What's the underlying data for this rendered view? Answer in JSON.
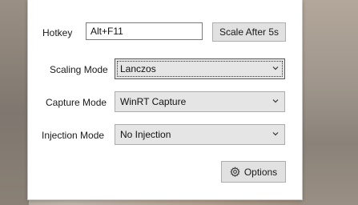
{
  "hotkey": {
    "label": "Hotkey",
    "value": "Alt+F11",
    "scale_button_label": "Scale After 5s"
  },
  "scaling_mode": {
    "label": "Scaling Mode",
    "selected": "Lanczos"
  },
  "capture_mode": {
    "label": "Capture Mode",
    "selected": "WinRT Capture"
  },
  "injection_mode": {
    "label": "Injection Mode",
    "selected": "No Injection"
  },
  "options_button": {
    "label": "Options",
    "icon": "gear-icon"
  },
  "colors": {
    "window_bg": "#ffffff",
    "control_bg": "#e1e1e1",
    "control_border": "#adadad"
  }
}
